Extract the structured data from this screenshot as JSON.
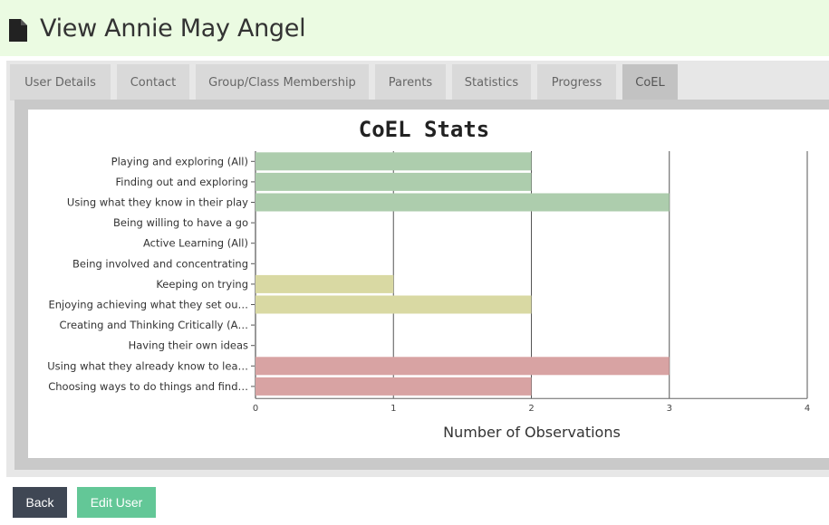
{
  "page": {
    "title": "View Annie May Angel"
  },
  "tabs": [
    {
      "label": "User Details"
    },
    {
      "label": "Contact"
    },
    {
      "label": "Group/Class Membership"
    },
    {
      "label": "Parents"
    },
    {
      "label": "Statistics"
    },
    {
      "label": "Progress"
    },
    {
      "label": "CoEL",
      "active": true
    }
  ],
  "buttons": {
    "back": "Back",
    "edit_user": "Edit User"
  },
  "colors": {
    "playing": "#adcdad",
    "active": "#d9d9a3",
    "creating": "#d8a3a3",
    "back_button": "#3f4754",
    "edit_button": "#63c797",
    "header_bg": "#ebfbe2"
  },
  "chart_data": {
    "type": "bar",
    "orientation": "horizontal",
    "title": "CoEL Stats",
    "xlabel": "Number of Observations",
    "ylabel": "",
    "xlim": [
      0,
      4
    ],
    "xticks": [
      "0",
      "1",
      "2",
      "3",
      "4"
    ],
    "grid": "vertical",
    "categories": [
      "Playing and exploring (All)",
      "Finding out and exploring",
      "Using what they know in their play",
      "Being willing to have a go",
      "Active Learning (All)",
      "Being involved and concentrating",
      "Keeping on trying",
      "Enjoying achieving what they set ou…",
      "Creating and Thinking Critically (A…",
      "Having their own ideas",
      "Using what they already know to lea…",
      "Choosing ways to do things and find…"
    ],
    "values": [
      2,
      2,
      3,
      0,
      0,
      0,
      1,
      2,
      0,
      0,
      3,
      2
    ],
    "bar_colors": [
      "#adcdad",
      "#adcdad",
      "#adcdad",
      "#adcdad",
      "#d9d9a3",
      "#d9d9a3",
      "#d9d9a3",
      "#d9d9a3",
      "#d8a3a3",
      "#d8a3a3",
      "#d8a3a3",
      "#d8a3a3"
    ]
  }
}
